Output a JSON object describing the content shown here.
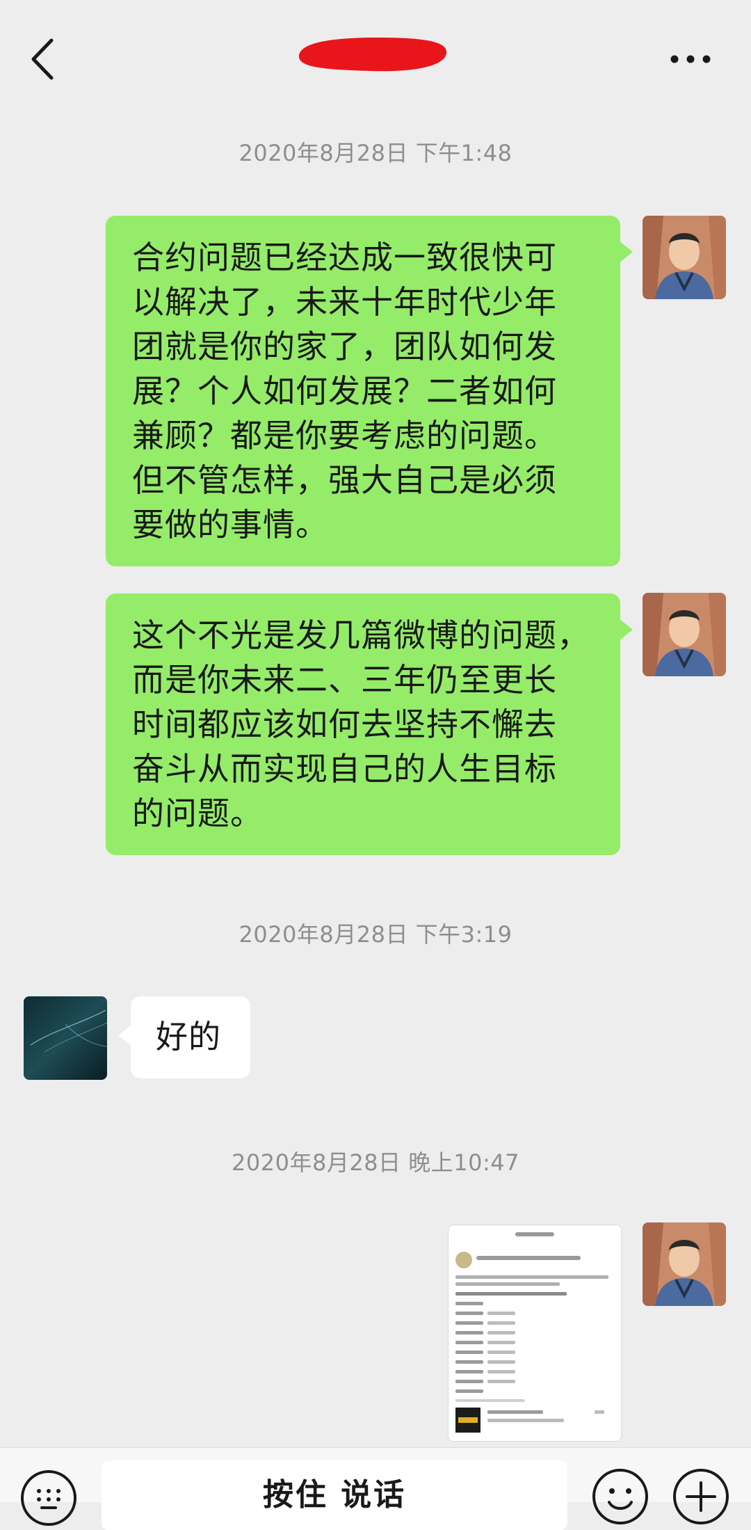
{
  "header": {
    "back_icon": "chevron-left-icon",
    "title_redaction_color": "#e8161a",
    "more_icon": "more-horizontal-icon"
  },
  "messages": [
    {
      "type": "timestamp",
      "text": "2020年8月28日 下午1:48"
    },
    {
      "type": "text",
      "side": "right",
      "text": "合约问题已经达成一致很快可\n以解决了，未来十年时代少年\n团就是你的家了，团队如何发\n展？个人如何发展？二者如何\n兼顾？都是你要考虑的问题。\n但不管怎样，强大自己是必须\n要做的事情。"
    },
    {
      "type": "text",
      "side": "right",
      "text": "这个不光是发几篇微博的问题，\n而是你未来二、三年仍至更长\n时间都应该如何去坚持不懈去\n奋斗从而实现自己的人生目标\n的问题。"
    },
    {
      "type": "timestamp",
      "text": "2020年8月28日 下午3:19"
    },
    {
      "type": "text",
      "side": "left",
      "text": "好的"
    },
    {
      "type": "timestamp",
      "text": "2020年8月28日 晚上10:47"
    },
    {
      "type": "image",
      "side": "right"
    }
  ],
  "input_bar": {
    "keyboard_icon": "keyboard-icon",
    "hold_to_talk_label": "按住 说话",
    "emoji_icon": "emoji-icon",
    "plus_icon": "plus-circle-icon"
  },
  "colors": {
    "background": "#ededed",
    "sent_bubble": "#95ec69",
    "received_bubble": "#ffffff",
    "timestamp_text": "#8e8e8e"
  }
}
